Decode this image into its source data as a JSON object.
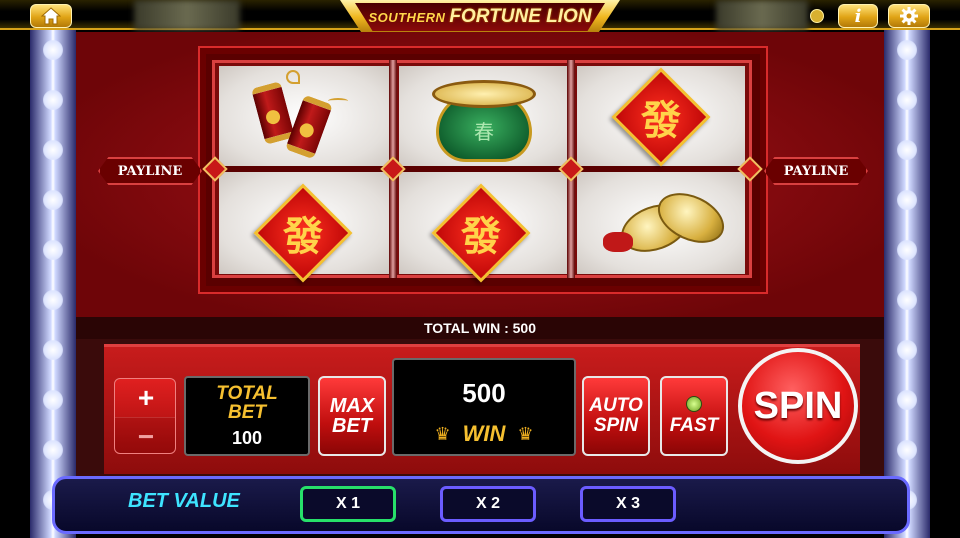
{
  "header": {
    "title_left": "SOUTHERN",
    "title_right": "FORTUNE LION",
    "home_icon": "home-icon",
    "info_label": "i",
    "settings_icon": "gear-icon"
  },
  "paylines": {
    "left_label": "PAYLINE",
    "right_label": "PAYLINE"
  },
  "reels": {
    "symbols": [
      [
        "firecrackers",
        "drum",
        "fa-tile"
      ],
      [
        "fa-tile",
        "fa-tile",
        "cymbals"
      ]
    ],
    "fa_char": "發",
    "drum_char": "春"
  },
  "total_win": {
    "text": "TOTAL WIN : 500"
  },
  "controls": {
    "plus_label": "+",
    "minus_label": "−",
    "total_bet_label_1": "TOTAL",
    "total_bet_label_2": "BET",
    "total_bet_value": "100",
    "max_bet_1": "MAX",
    "max_bet_2": "BET",
    "win_value": "500",
    "win_label": "WIN",
    "auto_spin_1": "AUTO",
    "auto_spin_2": "SPIN",
    "fast_label": "FAST",
    "spin_label": "SPIN"
  },
  "bet_value": {
    "label": "BET VALUE",
    "options": [
      {
        "label": "X 1",
        "selected": true,
        "border": "#27e06a"
      },
      {
        "label": "X 2",
        "selected": false,
        "border": "#6b5cff"
      },
      {
        "label": "X 3",
        "selected": false,
        "border": "#6b5cff"
      }
    ]
  },
  "colors": {
    "accent_gold": "#f6c030",
    "panel_red": "#c81c1c",
    "bet_cyan": "#3ee4ff"
  }
}
